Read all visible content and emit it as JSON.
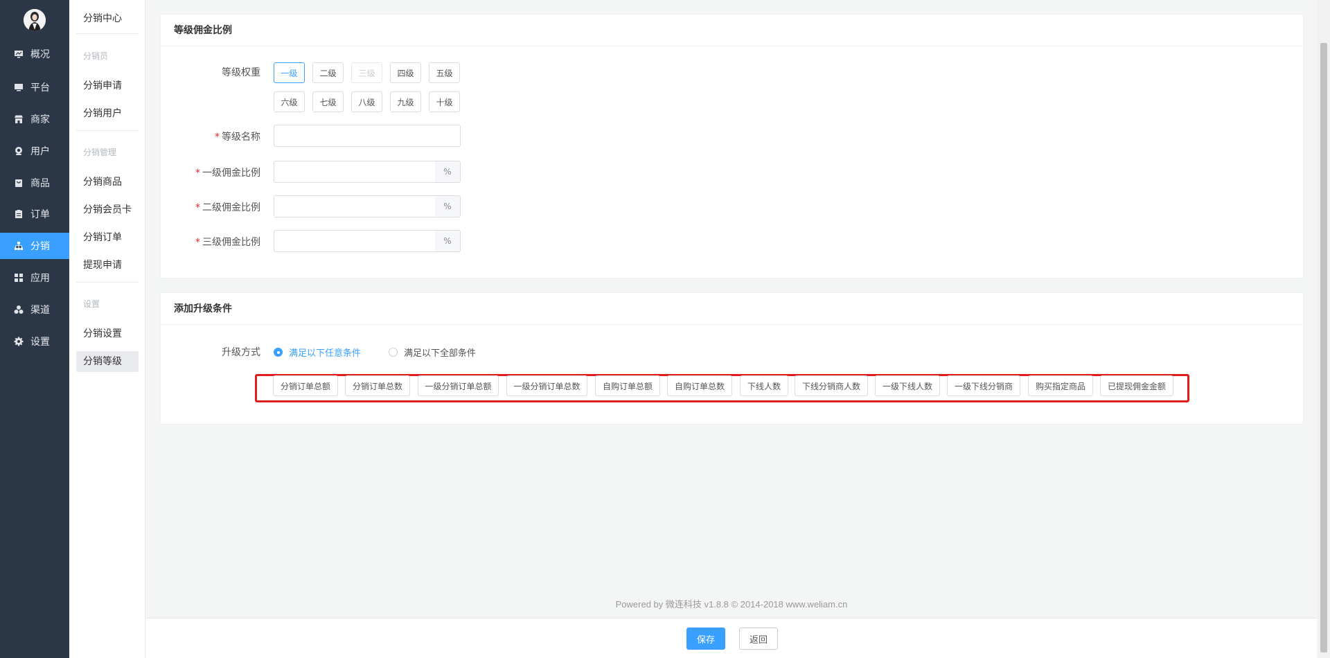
{
  "nav": {
    "items": [
      {
        "label": "概况",
        "icon": "monitor-chart-icon"
      },
      {
        "label": "平台",
        "icon": "desktop-icon"
      },
      {
        "label": "商家",
        "icon": "store-icon"
      },
      {
        "label": "用户",
        "icon": "user-icon"
      },
      {
        "label": "商品",
        "icon": "goods-bag-icon"
      },
      {
        "label": "订单",
        "icon": "order-clipboard-icon"
      },
      {
        "label": "分销",
        "icon": "distribution-tree-icon"
      },
      {
        "label": "应用",
        "icon": "apps-grid-icon"
      },
      {
        "label": "渠道",
        "icon": "channel-cluster-icon"
      },
      {
        "label": "设置",
        "icon": "gear-icon"
      }
    ],
    "active_index": 6
  },
  "subnav": {
    "title": "分销中心",
    "group_distributor": "分销员",
    "apply": "分销申请",
    "users": "分销用户",
    "group_manage": "分销管理",
    "goods": "分销商品",
    "member_card": "分销会员卡",
    "orders": "分销订单",
    "withdraw": "提现申请",
    "group_settings": "设置",
    "settings": "分销设置",
    "levels": "分销等级"
  },
  "level_panel": {
    "title": "等级佣金比例",
    "weight_label": "等级权重",
    "levels": [
      "一级",
      "二级",
      "三级",
      "四级",
      "五级",
      "六级",
      "七级",
      "八级",
      "九级",
      "十级"
    ],
    "selected": "一级",
    "disabled": [
      "三级"
    ],
    "required_mark": "*",
    "name_label": "等级名称",
    "name_value": "",
    "rate1_label": "一级佣金比例",
    "rate2_label": "二级佣金比例",
    "rate3_label": "三级佣金比例",
    "percent": "%"
  },
  "upgrade_panel": {
    "title": "添加升级条件",
    "mode_label": "升级方式",
    "mode_any": "满足以下任意条件",
    "mode_all": "满足以下全部条件",
    "selected_mode": "any",
    "conditions": [
      "分销订单总额",
      "分销订单总数",
      "一级分销订单总额",
      "一级分销订单总数",
      "自购订单总额",
      "自购订单总数",
      "下线人数",
      "下线分销商人数",
      "一级下线人数",
      "一级下线分销商",
      "购买指定商品",
      "已提现佣金金额"
    ],
    "highlight_color": "#e21b1b"
  },
  "footer": {
    "powered_by": "Powered by 微连科技 v1.8.8 © 2014-2018 www.weliam.cn"
  },
  "actions": {
    "save": "保存",
    "back": "返回"
  },
  "colors": {
    "sidebar_bg": "#2b3646",
    "accent": "#39a0ff"
  }
}
